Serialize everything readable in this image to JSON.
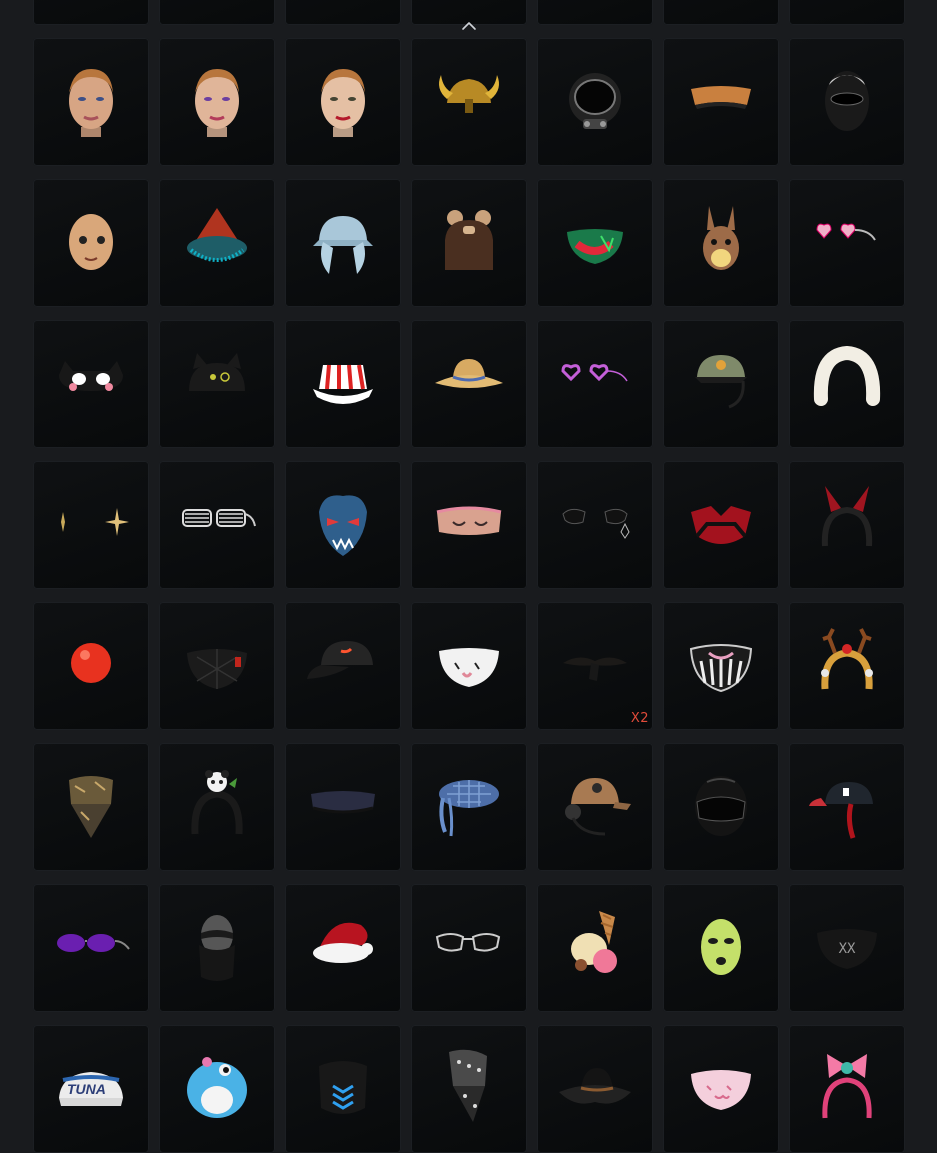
{
  "inventory": {
    "collapse_label": "collapse-up",
    "items": [
      {
        "name": "hidden-item-1",
        "icon": "item-icon",
        "qty": ""
      },
      {
        "name": "hidden-item-2",
        "icon": "item-icon",
        "qty": ""
      },
      {
        "name": "hidden-item-3",
        "icon": "item-icon",
        "qty": ""
      },
      {
        "name": "hidden-item-4",
        "icon": "item-icon",
        "qty": ""
      },
      {
        "name": "hidden-item-5",
        "icon": "item-icon",
        "qty": ""
      },
      {
        "name": "hidden-item-6",
        "icon": "item-icon",
        "qty": ""
      },
      {
        "name": "hidden-item-7",
        "icon": "item-icon",
        "qty": ""
      },
      {
        "name": "face-makeup-gold",
        "icon": "face-icon",
        "qty": ""
      },
      {
        "name": "face-makeup-clown",
        "icon": "face-icon",
        "qty": ""
      },
      {
        "name": "face-makeup-red-lips",
        "icon": "face-icon",
        "qty": ""
      },
      {
        "name": "gold-horned-helmet",
        "icon": "helmet-icon",
        "qty": ""
      },
      {
        "name": "space-helmet",
        "icon": "helmet-icon",
        "qty": ""
      },
      {
        "name": "orange-visor",
        "icon": "visor-icon",
        "qty": ""
      },
      {
        "name": "black-balaclava-helmet",
        "icon": "helmet-icon",
        "qty": ""
      },
      {
        "name": "wooden-doll-mask",
        "icon": "mask-icon",
        "qty": ""
      },
      {
        "name": "red-witch-hat",
        "icon": "hat-icon",
        "qty": ""
      },
      {
        "name": "blue-bunny-cap",
        "icon": "cap-icon",
        "qty": ""
      },
      {
        "name": "bear-ear-hair",
        "icon": "hair-icon",
        "qty": ""
      },
      {
        "name": "graffiti-face-mask",
        "icon": "mask-icon",
        "qty": ""
      },
      {
        "name": "bunny-head-mask",
        "icon": "mask-icon",
        "qty": ""
      },
      {
        "name": "heart-sunglasses-pink",
        "icon": "glasses-icon",
        "qty": ""
      },
      {
        "name": "cat-eye-mask",
        "icon": "mask-icon",
        "qty": ""
      },
      {
        "name": "black-cat-beanie",
        "icon": "hat-icon",
        "qty": ""
      },
      {
        "name": "striped-bucket-hat",
        "icon": "hat-icon",
        "qty": ""
      },
      {
        "name": "straw-sun-hat",
        "icon": "hat-icon",
        "qty": ""
      },
      {
        "name": "heart-glasses-purple",
        "icon": "glasses-icon",
        "qty": ""
      },
      {
        "name": "cap-with-headset",
        "icon": "cap-icon",
        "qty": ""
      },
      {
        "name": "fur-headband",
        "icon": "headband-icon",
        "qty": ""
      },
      {
        "name": "star-earrings",
        "icon": "earring-icon",
        "qty": ""
      },
      {
        "name": "shutter-shades",
        "icon": "glasses-icon",
        "qty": ""
      },
      {
        "name": "demon-mask",
        "icon": "mask-icon",
        "qty": ""
      },
      {
        "name": "sleep-eye-mask",
        "icon": "mask-icon",
        "qty": ""
      },
      {
        "name": "black-glasses-pendant",
        "icon": "glasses-icon",
        "qty": ""
      },
      {
        "name": "red-cyber-mask",
        "icon": "mask-icon",
        "qty": ""
      },
      {
        "name": "devil-ear-headband",
        "icon": "headband-icon",
        "qty": ""
      },
      {
        "name": "clown-nose",
        "icon": "nose-icon",
        "qty": ""
      },
      {
        "name": "black-quilted-mask",
        "icon": "mask-icon",
        "qty": ""
      },
      {
        "name": "black-baseball-cap",
        "icon": "cap-icon",
        "qty": ""
      },
      {
        "name": "white-smile-mask",
        "icon": "mask-icon",
        "qty": ""
      },
      {
        "name": "black-mustache",
        "icon": "mustache-icon",
        "qty": "X2"
      },
      {
        "name": "skeleton-mask",
        "icon": "mask-icon",
        "qty": ""
      },
      {
        "name": "reindeer-headband",
        "icon": "headband-icon",
        "qty": ""
      },
      {
        "name": "camo-bandana",
        "icon": "bandana-icon",
        "qty": ""
      },
      {
        "name": "panda-headband",
        "icon": "headband-icon",
        "qty": ""
      },
      {
        "name": "dark-blue-visor",
        "icon": "visor-icon",
        "qty": ""
      },
      {
        "name": "blue-plaid-beret",
        "icon": "hat-icon",
        "qty": ""
      },
      {
        "name": "aviator-cap-headset",
        "icon": "cap-icon",
        "qty": ""
      },
      {
        "name": "black-motorcycle-helmet",
        "icon": "helmet-icon",
        "qty": ""
      },
      {
        "name": "cap-with-red-tassel",
        "icon": "cap-icon",
        "qty": ""
      },
      {
        "name": "purple-sunglasses",
        "icon": "glasses-icon",
        "qty": ""
      },
      {
        "name": "ninja-mask",
        "icon": "mask-icon",
        "qty": ""
      },
      {
        "name": "santa-hat",
        "icon": "hat-icon",
        "qty": ""
      },
      {
        "name": "silver-sunglasses",
        "icon": "glasses-icon",
        "qty": ""
      },
      {
        "name": "ice-cream-hat",
        "icon": "hat-icon",
        "qty": ""
      },
      {
        "name": "green-balaclava",
        "icon": "mask-icon",
        "qty": ""
      },
      {
        "name": "black-logo-mask",
        "icon": "mask-icon",
        "qty": ""
      },
      {
        "name": "tuna-sailor-hat",
        "icon": "hat-icon",
        "qty": ""
      },
      {
        "name": "blue-fish-hat",
        "icon": "hat-icon",
        "qty": ""
      },
      {
        "name": "black-tech-mask",
        "icon": "mask-icon",
        "qty": ""
      },
      {
        "name": "studded-bandana",
        "icon": "bandana-icon",
        "qty": ""
      },
      {
        "name": "black-cowboy-hat",
        "icon": "hat-icon",
        "qty": ""
      },
      {
        "name": "pink-cat-mask",
        "icon": "mask-icon",
        "qty": ""
      },
      {
        "name": "pink-bow-headband",
        "icon": "headband-icon",
        "qty": ""
      }
    ],
    "tuna_text": "TUNA",
    "logo_mask_text": "XX"
  },
  "colors": {
    "background": "#191b1e",
    "tile": "#0b0d0f",
    "tile_border": "#1c1f23",
    "qty": "#e04b3a"
  }
}
